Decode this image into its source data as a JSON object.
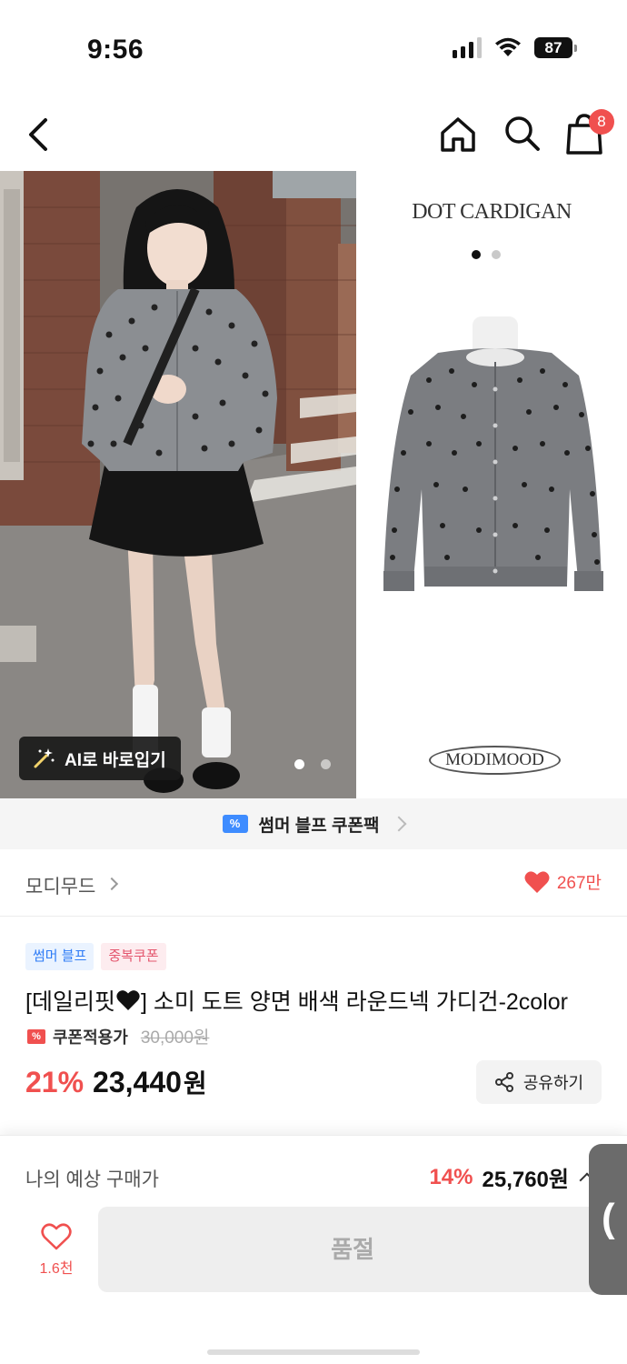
{
  "status_bar": {
    "time": "9:56",
    "battery": "87"
  },
  "nav": {
    "cart_count": "8"
  },
  "gallery": {
    "product_title": "DOT CARDIGAN",
    "brand_logo": "MODIMOOD",
    "ai_button_label": "AI로 바로입기",
    "photo_index": 1,
    "photo_total": 2
  },
  "coupon_banner": {
    "icon": "%",
    "text": "썸머 블프 쿠폰팩"
  },
  "store": {
    "name": "모디무드",
    "like_count": "267만"
  },
  "product": {
    "tags": [
      "썸머 블프",
      "중복쿠폰"
    ],
    "name_prefix": "[데일리핏",
    "name_suffix": "] 소미 도트 양면 배색 라운드넥 가디건-2color",
    "coupon_label": "쿠폰적용가",
    "original_price": "30,000원",
    "discount": "21%",
    "price": "23,440",
    "price_unit": "원",
    "share_label": "공유하기"
  },
  "expected": {
    "label": "나의 예상 구매가",
    "discount": "14%",
    "price": "25,760원"
  },
  "bottom": {
    "wish_count": "1.6천",
    "soldout_label": "품절"
  },
  "side_tab": {
    "glyph": "("
  },
  "colors": {
    "accent_red": "#f0504f",
    "tag_blue": "#2f7cf6",
    "tag_pink": "#e4566e"
  }
}
